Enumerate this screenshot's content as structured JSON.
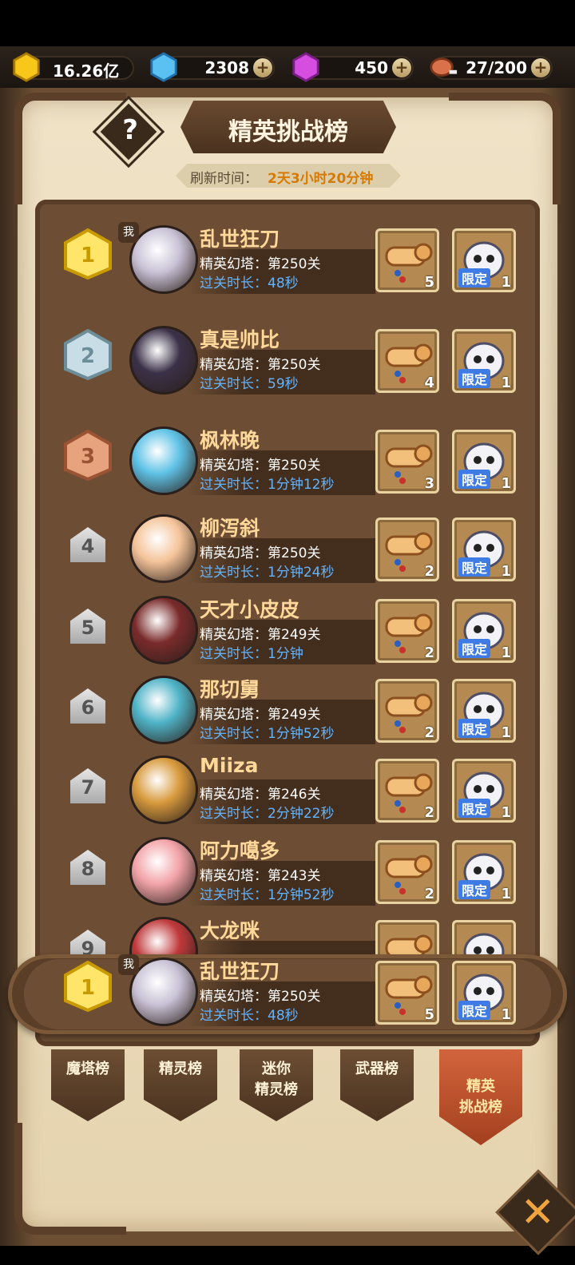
{
  "resources": {
    "gold": "16.26亿",
    "diamond": "2308",
    "crystal": "450",
    "stamina": "27/200",
    "plus": "+"
  },
  "header": {
    "help": "?",
    "title": "精英挑战榜",
    "refresh_label": "刷新时间：",
    "refresh_value": "2天3小时20分钟"
  },
  "labels": {
    "me_tag": "我",
    "limited": "限定"
  },
  "rows": [
    {
      "rank": "1",
      "name": "乱世狂刀",
      "tower": "精英幻塔：第250关",
      "time": "过关时长：48秒",
      "scroll": "5",
      "pet": "1"
    },
    {
      "rank": "2",
      "name": "真是帅比",
      "tower": "精英幻塔：第250关",
      "time": "过关时长：59秒",
      "scroll": "4",
      "pet": "1"
    },
    {
      "rank": "3",
      "name": "枫林晚",
      "tower": "精英幻塔：第250关",
      "time": "过关时长：1分钟12秒",
      "scroll": "3",
      "pet": "1"
    },
    {
      "rank": "4",
      "name": "柳泻斜",
      "tower": "精英幻塔：第250关",
      "time": "过关时长：1分钟24秒",
      "scroll": "2",
      "pet": "1"
    },
    {
      "rank": "5",
      "name": "天才小皮皮",
      "tower": "精英幻塔：第249关",
      "time": "过关时长：1分钟",
      "scroll": "2",
      "pet": "1"
    },
    {
      "rank": "6",
      "name": "那切舅",
      "tower": "精英幻塔：第249关",
      "time": "过关时长：1分钟52秒",
      "scroll": "2",
      "pet": "1"
    },
    {
      "rank": "7",
      "name": "Miiza",
      "tower": "精英幻塔：第246关",
      "time": "过关时长：2分钟22秒",
      "scroll": "2",
      "pet": "1"
    },
    {
      "rank": "8",
      "name": "阿力噶多",
      "tower": "精英幻塔：第243关",
      "time": "过关时长：1分钟52秒",
      "scroll": "2",
      "pet": "1"
    },
    {
      "rank": "9",
      "name": "大龙咪",
      "tower": "",
      "time": "",
      "scroll": "",
      "pet": ""
    }
  ],
  "my_rank": {
    "rank": "1",
    "name": "乱世狂刀",
    "tower": "精英幻塔：第250关",
    "time": "过关时长：48秒",
    "scroll": "5",
    "pet": "1"
  },
  "tabs": [
    {
      "label": "魔塔榜"
    },
    {
      "label": "精灵榜"
    },
    {
      "label": "迷你\n精灵榜"
    },
    {
      "label": "武器榜"
    },
    {
      "label": "精英\n挑战榜"
    }
  ],
  "close": "✕"
}
